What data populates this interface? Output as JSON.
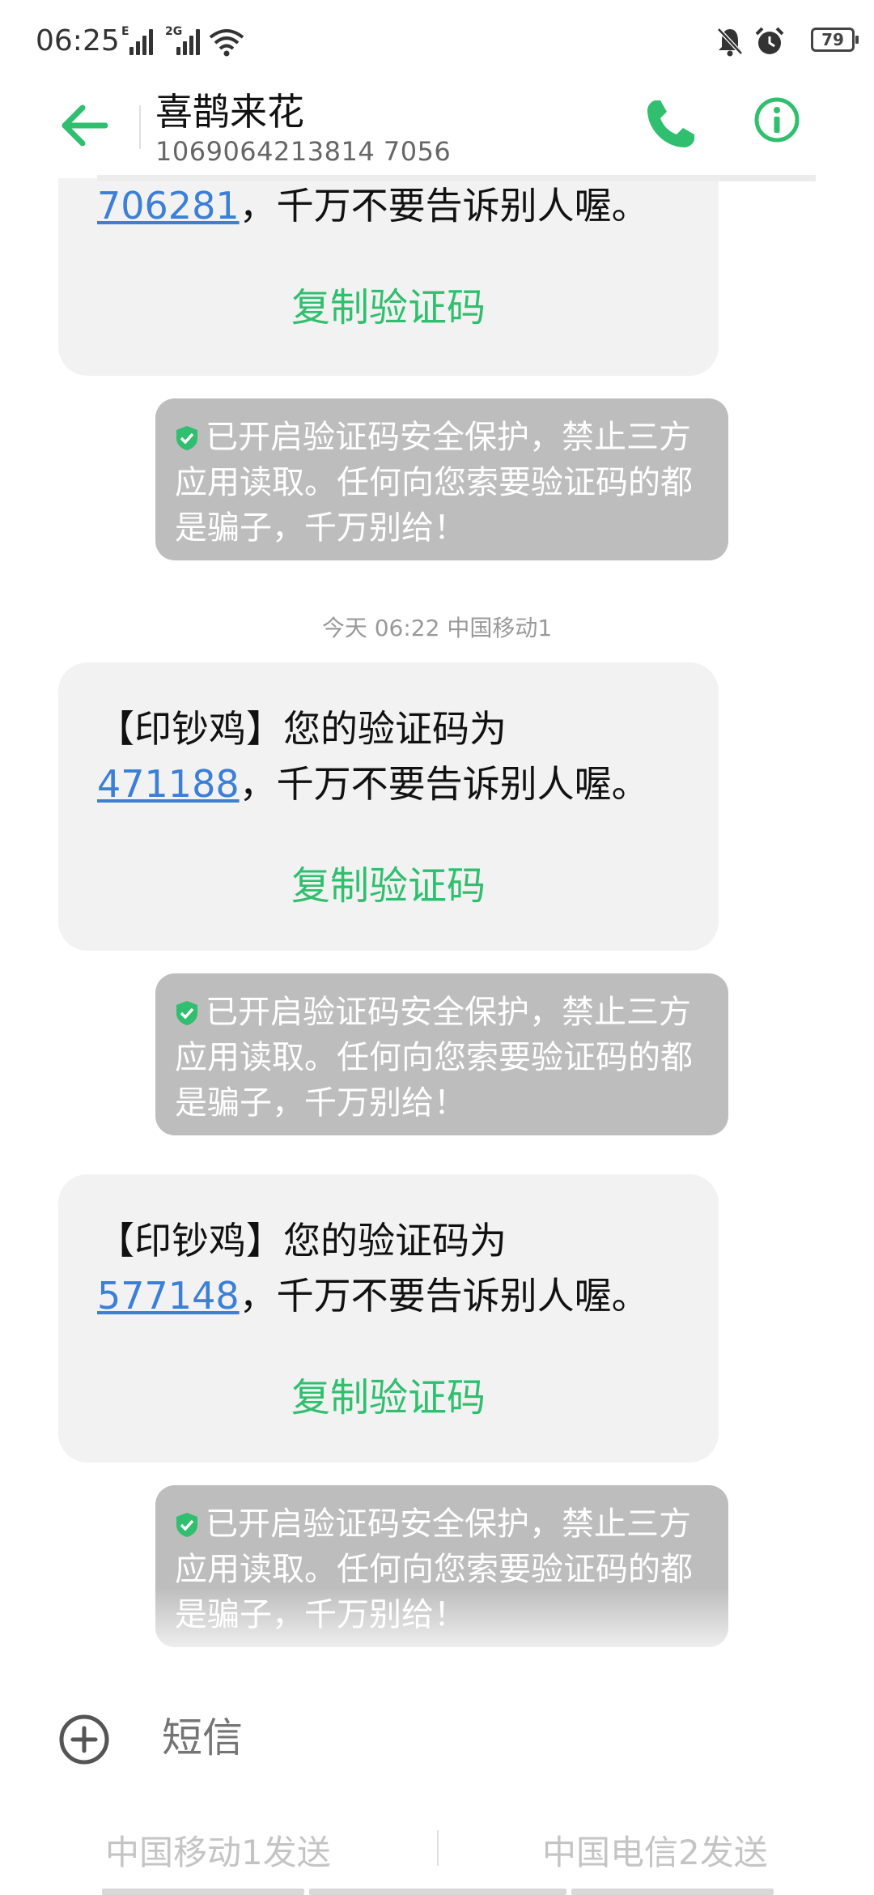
{
  "status": {
    "time": "06:25",
    "signal1_label": "E",
    "signal2_label": "2G",
    "battery": "79"
  },
  "header": {
    "contact_name": "喜鹊来花",
    "contact_number": "1069064213814 7056"
  },
  "messages": [
    {
      "prefix": "",
      "code": "706281",
      "suffix": "，千万不要告诉别人喔。",
      "copy_label": "复制验证码"
    },
    {
      "prefix": "【印钞鸡】您的验证码为",
      "code": "471188",
      "suffix": "，千万不要告诉别人喔。",
      "copy_label": "复制验证码"
    },
    {
      "prefix": "【印钞鸡】您的验证码为",
      "code": "577148",
      "suffix": "，千万不要告诉别人喔。",
      "copy_label": "复制验证码"
    }
  ],
  "notice_text": "已开启验证码安全保护，禁止三方应用读取。任何向您索要验证码的都是骗子，千万别给！",
  "timestamp": "今天 06:22  中国移动1",
  "composer": {
    "placeholder": "短信",
    "send_sim1": "中国移动1发送",
    "send_sim2": "中国电信2发送"
  },
  "colors": {
    "accent": "#2fbf6e",
    "link": "#3b7fd6",
    "bubble": "#f2f2f2",
    "notice": "#bdbdbd"
  }
}
